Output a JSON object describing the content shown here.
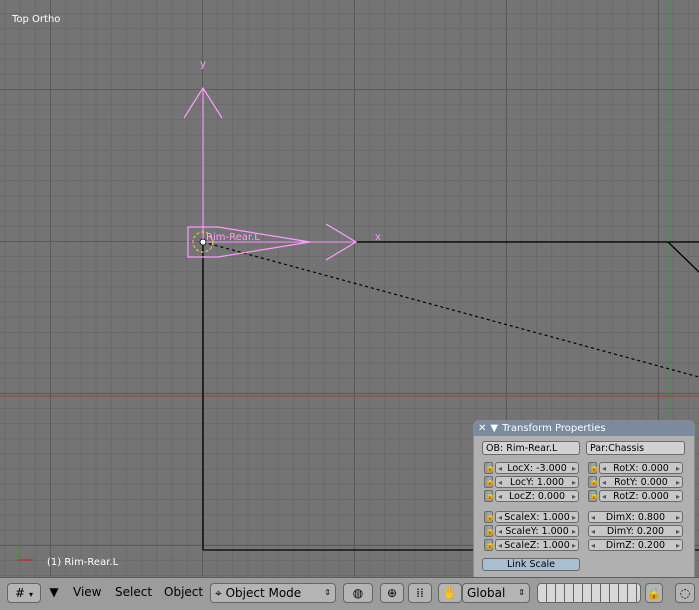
{
  "viewport": {
    "view_name": "Top Ortho",
    "object_status": "(1) Rim-Rear.L",
    "object_label": "Rim-Rear.L",
    "axis_y": "y",
    "axis_x": "x",
    "colors": {
      "background": "#747474",
      "selection": "#ff9cff",
      "wire": "#000000",
      "axis_red": "#b03030",
      "axis_green": "#30a030"
    }
  },
  "transform_panel": {
    "title": "Transform Properties",
    "collapse_icon": "triangle-down-icon",
    "close_icon": "close-x-icon",
    "object_name": "OB: Rim-Rear.L",
    "parent": "Par:Chassis",
    "location": [
      {
        "label": "LocX: -3.000"
      },
      {
        "label": "LocY: 1.000"
      },
      {
        "label": "LocZ: 0.000"
      }
    ],
    "rotation": [
      {
        "label": "RotX: 0.000"
      },
      {
        "label": "RotY: 0.000"
      },
      {
        "label": "RotZ: 0.000"
      }
    ],
    "scale": [
      {
        "label": "ScaleX: 1.000"
      },
      {
        "label": "ScaleY: 1.000"
      },
      {
        "label": "ScaleZ: 1.000"
      }
    ],
    "dimensions": [
      {
        "label": "DimX: 0.800"
      },
      {
        "label": "DimY: 0.200"
      },
      {
        "label": "DimZ: 0.200"
      }
    ],
    "link_scale": "Link Scale"
  },
  "header": {
    "editor_type_icon": "grid-icon",
    "menus": [
      "View",
      "Select",
      "Object"
    ],
    "mode": "Object Mode",
    "orientation": "Global",
    "icons": [
      "draw-type-icon",
      "pivot-icon",
      "dots-icon",
      "hand-manipulator-icon",
      "layers-icon",
      "lock-icon",
      "render-icon"
    ]
  }
}
